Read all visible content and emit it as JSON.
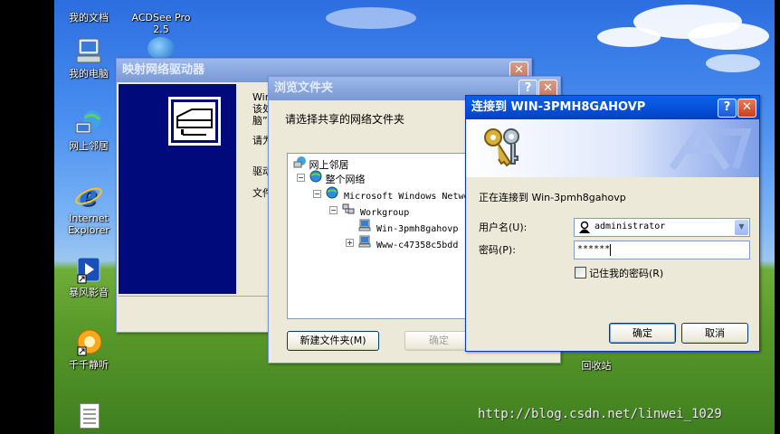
{
  "desktop": {
    "icons": [
      {
        "label": "我的文档",
        "icon": "my-documents-icon"
      },
      {
        "label": "ACDSee Pro 2.5",
        "icon": "acdsee-icon"
      },
      {
        "label": "我的电脑",
        "icon": "my-computer-icon"
      },
      {
        "label": "网上邻居",
        "icon": "network-places-icon"
      },
      {
        "label": "Internet Explorer",
        "icon": "internet-explorer-icon"
      },
      {
        "label": "暴风影音",
        "icon": "baofeng-icon"
      },
      {
        "label": "千千静听",
        "icon": "ttplayer-icon"
      },
      {
        "label": "回收站",
        "icon": "recycle-bin-icon"
      }
    ],
    "watermark": "http://blog.csdn.net/linwei_1029"
  },
  "map_drive_dialog": {
    "title": "映射网络驱动器",
    "text_fragments": [
      "Win",
      "该处",
      "脑”",
      "请为",
      "驱动",
      "文件"
    ]
  },
  "browse_dialog": {
    "title": "浏览文件夹",
    "prompt": "请选择共享的网络文件夹",
    "tree": [
      {
        "label": "网上邻居",
        "level": 0
      },
      {
        "label": "整个网络",
        "level": 1,
        "expander": "−"
      },
      {
        "label": "Microsoft Windows Netwo",
        "level": 2,
        "expander": "−"
      },
      {
        "label": "Workgroup",
        "level": 3,
        "expander": "−"
      },
      {
        "label": "Win-3pmh8gahovp",
        "level": 4
      },
      {
        "label": "Www-c47358c5bdd",
        "level": 4,
        "expander": "+"
      }
    ],
    "new_folder_button": "新建文件夹(M)",
    "ok_button": "确定"
  },
  "connect_dialog": {
    "title": "连接到 WIN-3PMH8GAHOVP",
    "connecting_text": "正在连接到 Win-3pmh8gahovp",
    "username_label": "用户名(U):",
    "username_value": "administrator",
    "password_label": "密码(P):",
    "password_value": "******",
    "remember_label": "记住我的密码(R)",
    "remember_checked": false,
    "ok_button": "确定",
    "cancel_button": "取消"
  },
  "title_buttons": {
    "help": "?",
    "close": "✕"
  }
}
